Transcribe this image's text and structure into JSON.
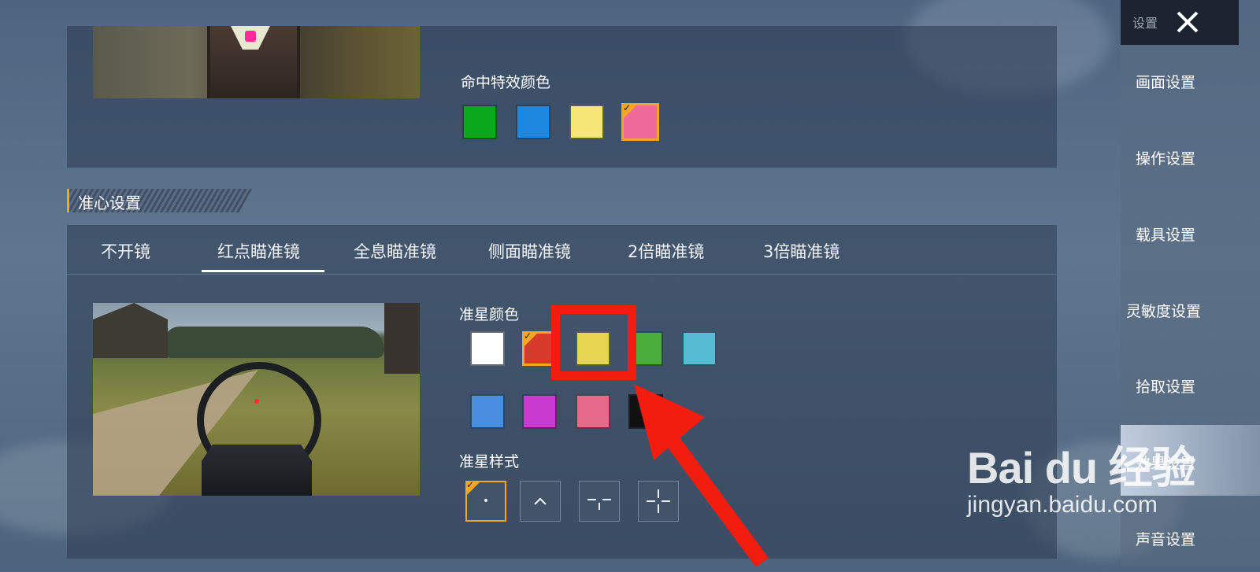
{
  "hit_effect": {
    "label": "命中特效颜色",
    "colors": [
      "#08a81a",
      "#1e88e0",
      "#f5e676",
      "#f06a9a"
    ],
    "selected_index": 3
  },
  "crosshair_section": {
    "title": "准心设置"
  },
  "scope_tabs": {
    "items": [
      "不开镜",
      "红点瞄准镜",
      "全息瞄准镜",
      "侧面瞄准镜",
      "2倍瞄准镜",
      "3倍瞄准镜"
    ],
    "active_index": 1
  },
  "crosshair_color": {
    "label": "准星颜色",
    "colors": [
      "#ffffff",
      "#d63a2a",
      "#e6d550",
      "#4cae3a",
      "#56bcd4",
      "#4a8ee0",
      "#c93ad0",
      "#e86a8a",
      "#111111"
    ],
    "selected_index": 1,
    "highlighted_index": 2
  },
  "crosshair_style": {
    "label": "准星样式",
    "options": [
      "dot-icon",
      "chevron-up-icon",
      "tee-crosshair-icon",
      "cross-crosshair-icon"
    ],
    "selected_index": 0
  },
  "sidebar": {
    "title": "设置",
    "items": [
      "画面设置",
      "操作设置",
      "载具设置",
      "灵敏度设置",
      "拾取设置",
      "效果设置",
      "声音设置"
    ],
    "active_index": 5
  },
  "watermark": {
    "logo": "Bai du 经验",
    "url": "jingyan.baidu.com"
  },
  "accent_color": "#f5a623",
  "annotation_color": "#f21d0e"
}
